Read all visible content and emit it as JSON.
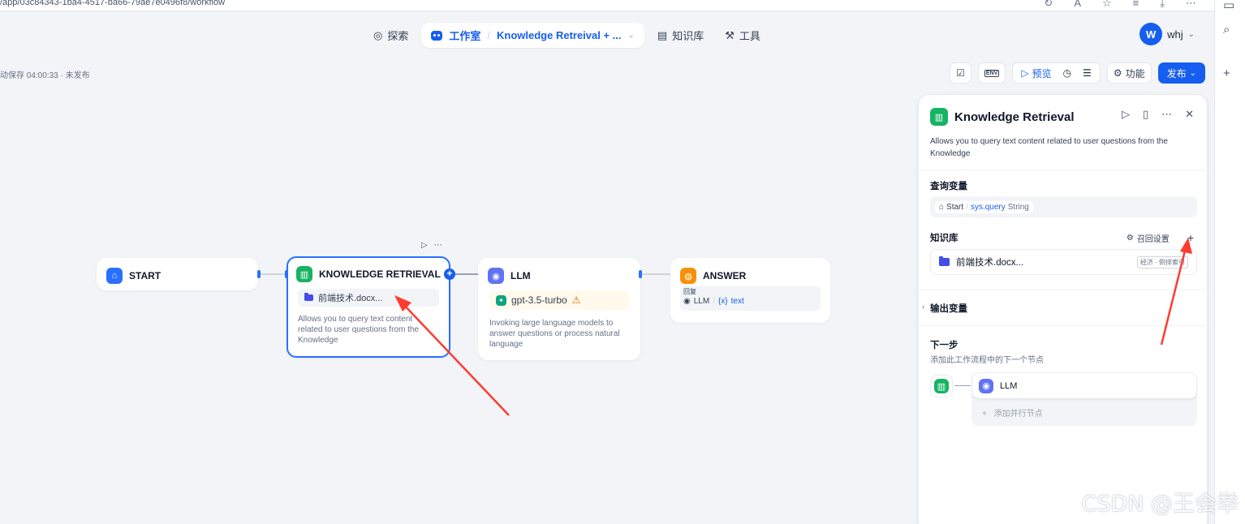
{
  "browser": {
    "url": "/app/03c84343-1ba4-4517-ba66-79ae7e0496f8/workflow"
  },
  "nav": {
    "explore": "探索",
    "studio": "工作室",
    "app_name": "Knowledge Retreival + ...",
    "knowledge": "知识库",
    "tools": "工具"
  },
  "user": {
    "initial": "W",
    "name": "whj"
  },
  "status": {
    "autosave": "动保存 04:00:33 · 未发布"
  },
  "toolbar": {
    "env": "ENV",
    "preview": "预览",
    "features": "功能",
    "publish": "发布"
  },
  "nodes": {
    "start": {
      "title": "START"
    },
    "knowledge": {
      "title": "KNOWLEDGE RETRIEVAL",
      "dataset": "前端技术.docx...",
      "desc": "Allows you to query text content related to user questions from the Knowledge"
    },
    "llm": {
      "title": "LLM",
      "model": "gpt-3.5-turbo",
      "desc": "Invoking large language models to answer questions or process natural language"
    },
    "answer": {
      "title": "ANSWER",
      "label": "回复",
      "var_node": "LLM",
      "var_sep": "/",
      "var_icon": "{x}",
      "var_name": "text"
    }
  },
  "panel": {
    "title": "Knowledge Retrieval",
    "desc": "Allows you to query text content related to user questions from the Knowledge",
    "query_label": "查询变量",
    "query_var": {
      "node": "Start",
      "sep": "/",
      "name": "sys.query",
      "type": "String"
    },
    "kb_label": "知识库",
    "recall_settings": "召回设置",
    "kb_item": {
      "name": "前端技术.docx...",
      "badge": "经济 · 倒排索引"
    },
    "output_label": "输出变量",
    "next_label": "下一步",
    "next_sub": "添加此工作流程中的下一个节点",
    "next_node": "LLM",
    "add_parallel": "添加并行节点"
  },
  "watermark": "CSDN @王会举",
  "colors": {
    "primary": "#155eef",
    "annotation_arrow": "#ff3b30",
    "kb_icon": "#16b364",
    "llm_icon": "#6172f3",
    "answer_icon": "#f79009"
  }
}
